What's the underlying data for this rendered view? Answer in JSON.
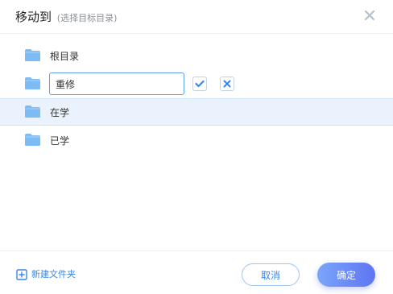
{
  "dialog": {
    "title": "移动到",
    "subtitle": "(选择目标目录)"
  },
  "folders": [
    {
      "label": "根目录"
    },
    {
      "label": "在学",
      "selected": true
    },
    {
      "label": "已学"
    }
  ],
  "rename": {
    "value": "重修"
  },
  "footer": {
    "new_folder_label": "新建文件夹",
    "cancel_label": "取消",
    "ok_label": "确定"
  },
  "icons": {
    "folder": "folder-icon",
    "close": "close-icon",
    "confirm": "checkmark-icon",
    "cancel": "x-icon",
    "new_folder": "plus-square-icon"
  },
  "colors": {
    "accent": "#3a86e8",
    "folder": "#7dbbf5",
    "selected_row": "#eaf3fd",
    "primary_button_start": "#7aa6fb",
    "primary_button_end": "#5f74f2"
  }
}
